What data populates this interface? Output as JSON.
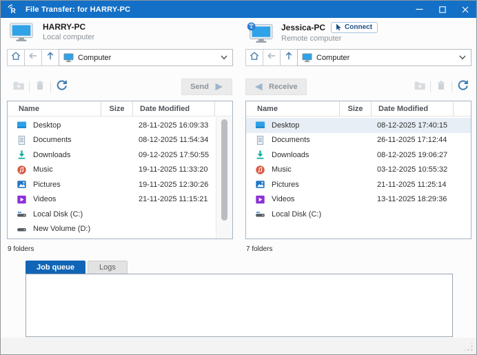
{
  "window": {
    "title": "File Transfer: for HARRY-PC"
  },
  "colors": {
    "titlebar_blue": "#1470c6",
    "accent_blue": "#3f7cb0",
    "tab_active_blue": "#1165b6",
    "selected_row": "#e7eef5",
    "connect_text": "#1d4e86"
  },
  "nav_icons": [
    "home-icon",
    "back-icon",
    "up-icon"
  ],
  "toolbar_icons": [
    "new-folder-icon",
    "delete-icon",
    "refresh-icon"
  ],
  "left_panel": {
    "computer_name": "HARRY-PC",
    "computer_type": "Local computer",
    "address": "Computer",
    "send_label": "Send",
    "status": "9 folders",
    "columns": [
      "Name",
      "Size",
      "Date Modified"
    ],
    "rows": [
      {
        "icon": "desktop-folder-icon",
        "name": "Desktop",
        "size": "",
        "date": "28-11-2025 16:09:33"
      },
      {
        "icon": "documents-folder-icon",
        "name": "Documents",
        "size": "",
        "date": "08-12-2025 11:54:34"
      },
      {
        "icon": "downloads-folder-icon",
        "name": "Downloads",
        "size": "",
        "date": "09-12-2025 17:50:55"
      },
      {
        "icon": "music-folder-icon",
        "name": "Music",
        "size": "",
        "date": "19-11-2025 11:33:20"
      },
      {
        "icon": "pictures-folder-icon",
        "name": "Pictures",
        "size": "",
        "date": "19-11-2025 12:30:26"
      },
      {
        "icon": "videos-folder-icon",
        "name": "Videos",
        "size": "",
        "date": "21-11-2025 11:15:21"
      },
      {
        "icon": "local-disk-icon",
        "name": "Local Disk (C:)",
        "size": "",
        "date": ""
      },
      {
        "icon": "disk-icon",
        "name": "New Volume (D:)",
        "size": "",
        "date": ""
      }
    ]
  },
  "right_panel": {
    "computer_name": "Jessica-PC",
    "computer_type": "Remote computer",
    "connect_label": "Connect",
    "address": "Computer",
    "receive_label": "Receive",
    "status": "7 folders",
    "columns": [
      "Name",
      "Size",
      "Date Modified"
    ],
    "rows": [
      {
        "icon": "desktop-folder-icon",
        "name": "Desktop",
        "size": "",
        "date": "08-12-2025 17:40:15",
        "selected": true
      },
      {
        "icon": "documents-folder-icon",
        "name": "Documents",
        "size": "",
        "date": "26-11-2025 17:12:44"
      },
      {
        "icon": "downloads-folder-icon",
        "name": "Downloads",
        "size": "",
        "date": "08-12-2025 19:06:27"
      },
      {
        "icon": "music-folder-icon",
        "name": "Music",
        "size": "",
        "date": "03-12-2025 10:55:32"
      },
      {
        "icon": "pictures-folder-icon",
        "name": "Pictures",
        "size": "",
        "date": "21-11-2025 11:25:14"
      },
      {
        "icon": "videos-folder-icon",
        "name": "Videos",
        "size": "",
        "date": "13-11-2025 18:29:36"
      },
      {
        "icon": "local-disk-icon",
        "name": "Local Disk (C:)",
        "size": "",
        "date": ""
      }
    ]
  },
  "tabs": [
    {
      "label": "Job queue",
      "active": true
    },
    {
      "label": "Logs",
      "active": false
    }
  ]
}
